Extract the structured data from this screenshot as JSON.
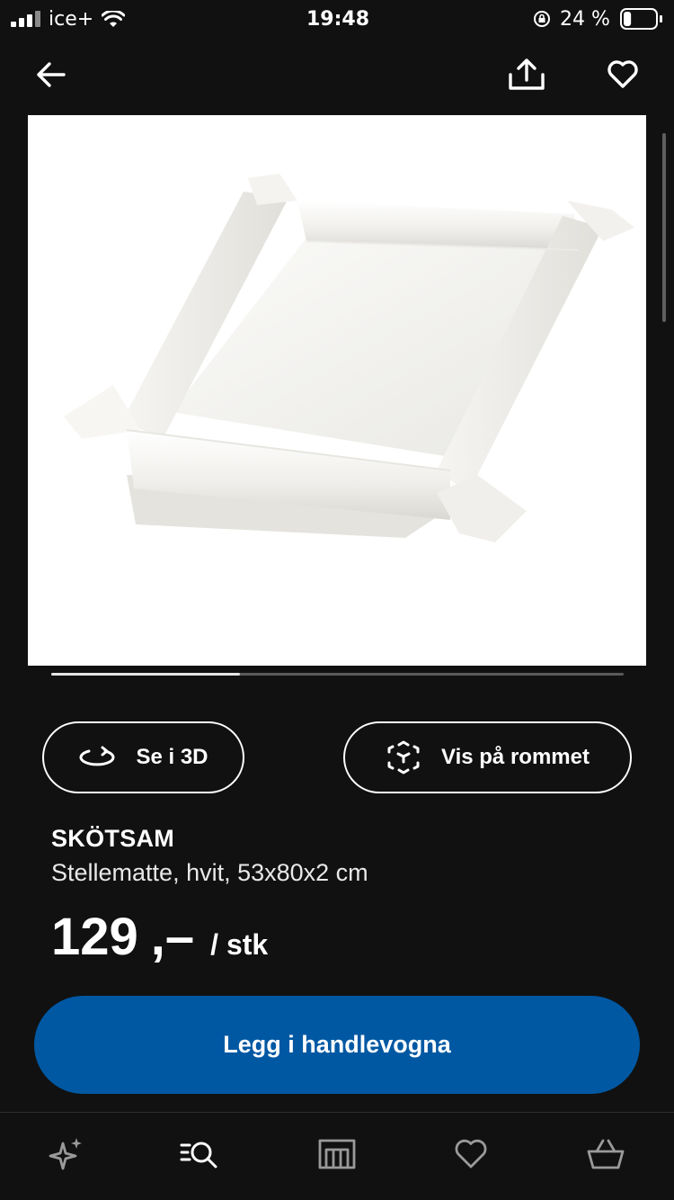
{
  "status_bar": {
    "carrier": "ice+",
    "time": "19:48",
    "battery": "24 %",
    "battery_level": 0.24
  },
  "header": {
    "back_icon": "arrow-left-icon",
    "share_icon": "share-icon",
    "favorite_icon": "heart-outline-icon"
  },
  "gallery": {
    "image_subject": "white changing mat",
    "progress": 0.33
  },
  "actions": {
    "view_3d_label": "Se i 3D",
    "view_3d_icon": "rotate-3d-icon",
    "view_room_label": "Vis på rommet",
    "view_room_icon": "ar-cube-icon"
  },
  "product": {
    "name": "SKÖTSAM",
    "description": "Stellematte, hvit, 53x80x2 cm",
    "price_integer": "129",
    "price_decimal": ",–",
    "price_unit": "/ stk"
  },
  "cart_button": {
    "label": "Legg i handlevogna",
    "color": "#0058a3"
  },
  "tab_bar": {
    "items": [
      "sparkle-icon",
      "search-list-icon",
      "store-icon",
      "heart-icon",
      "basket-icon"
    ]
  }
}
